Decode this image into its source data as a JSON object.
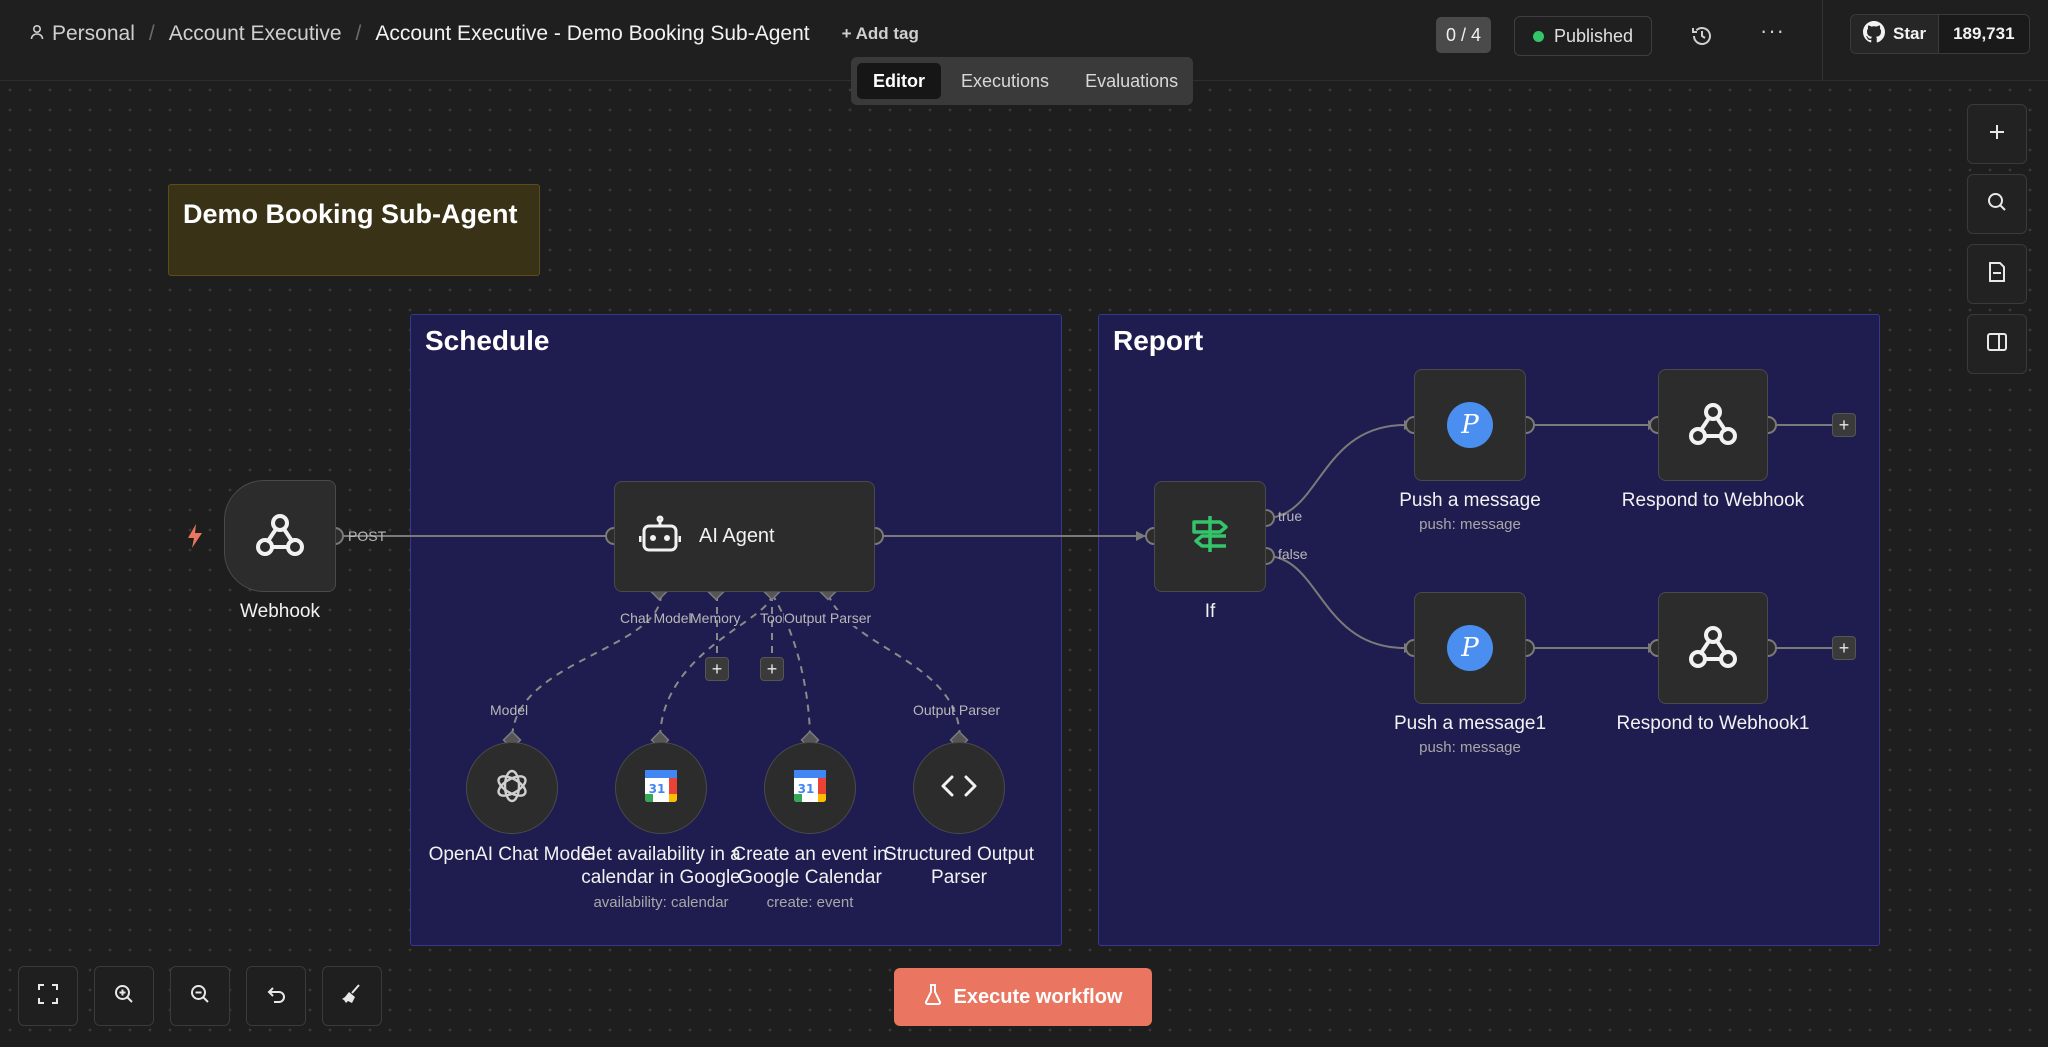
{
  "breadcrumb": {
    "personal": "Personal",
    "project": "Account Executive",
    "workflow": "Account Executive - Demo Booking Sub-Agent",
    "add_tag": "+ Add tag"
  },
  "tabs": [
    {
      "label": "Editor",
      "active": true
    },
    {
      "label": "Executions",
      "active": false
    },
    {
      "label": "Evaluations",
      "active": false
    }
  ],
  "header": {
    "counter": "0 / 4",
    "status": "Published",
    "status_color": "#34c46a",
    "more": "···",
    "github_star": "Star",
    "github_count": "189,731"
  },
  "sticky": {
    "title": "Demo Booking Sub-Agent"
  },
  "groups": {
    "schedule": "Schedule",
    "report": "Report"
  },
  "nodes": {
    "webhook": {
      "label": "Webhook",
      "port": "POST"
    },
    "ai_agent": {
      "label": "AI Agent",
      "ports": [
        "Chat Model",
        "Memory",
        "Tool",
        "Output Parser"
      ]
    },
    "openai": {
      "label": "OpenAI Chat Model",
      "port": "Model"
    },
    "get_availability": {
      "label_1": "Get availability in a",
      "label_2": "calendar in Google",
      "sub": "availability: calendar"
    },
    "create_event": {
      "label_1": "Create an event in",
      "label_2": "Google Calendar",
      "sub": "create: event"
    },
    "output_parser": {
      "label_1": "Structured Output",
      "label_2": "Parser",
      "port": "Output Parser"
    },
    "if": {
      "label": "If",
      "true": "true",
      "false": "false"
    },
    "push1": {
      "label": "Push a message",
      "sub": "push: message"
    },
    "respond1": {
      "label": "Respond to Webhook"
    },
    "push2": {
      "label": "Push a message1",
      "sub": "push: message"
    },
    "respond2": {
      "label": "Respond to Webhook1"
    }
  },
  "execute_button": "Execute workflow",
  "accent": "#ea7560"
}
